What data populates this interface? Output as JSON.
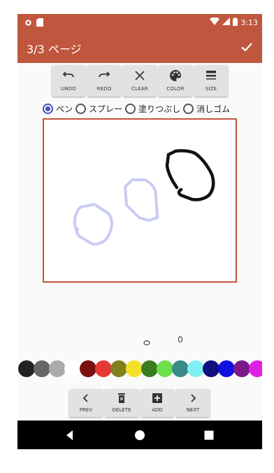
{
  "status_bar": {
    "time": "3:13",
    "icons": [
      "notification-dot-icon",
      "sd-card-icon",
      "wifi-icon",
      "signal-icon",
      "battery-icon"
    ]
  },
  "app_bar": {
    "title": "3/3 ページ",
    "confirm_icon": "check-icon"
  },
  "toolbar": {
    "buttons": [
      {
        "label": "UNDO",
        "icon": "undo-icon"
      },
      {
        "label": "REDO",
        "icon": "redo-icon"
      },
      {
        "label": "CLEAR",
        "icon": "close-icon"
      },
      {
        "label": "COLOR",
        "icon": "palette-icon"
      },
      {
        "label": "SIZE",
        "icon": "line-weight-icon"
      }
    ]
  },
  "modes": {
    "selected": "ペン",
    "options": [
      {
        "label": "ペン",
        "selected": true
      },
      {
        "label": "スプレー",
        "selected": false
      },
      {
        "label": "塗りつぶし",
        "selected": false
      },
      {
        "label": "消しゴム",
        "selected": false
      }
    ]
  },
  "colors": {
    "accent": "#c0563d",
    "radio_selected": "#3f51b5",
    "palette": [
      "#222222",
      "#666666",
      "#aaaaaa",
      "#ffffff",
      "#7b1010",
      "#e53935",
      "#808020",
      "#f5e027",
      "#3a7d1e",
      "#6be04a",
      "#3a8a8a",
      "#80f0f5",
      "#101080",
      "#1010e0",
      "#7a1a8a",
      "#e020e0"
    ]
  },
  "page_bar": {
    "buttons": [
      {
        "label": "PREV",
        "icon": "chevron-left-icon"
      },
      {
        "label": "DELETE",
        "icon": "delete-icon"
      },
      {
        "label": "ADD",
        "icon": "add-box-icon"
      },
      {
        "label": "NEXT",
        "icon": "chevron-right-icon"
      }
    ]
  },
  "nav_bar": {
    "icons": [
      "back-icon",
      "home-icon",
      "recents-icon"
    ]
  }
}
